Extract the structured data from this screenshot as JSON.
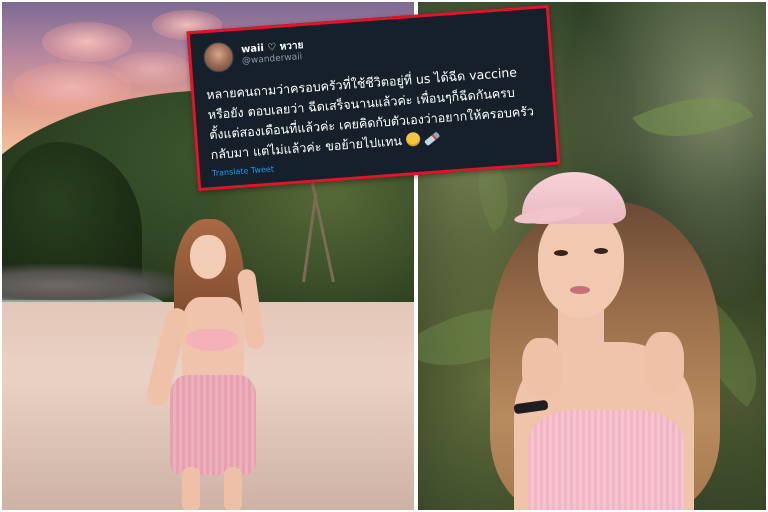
{
  "tweet": {
    "display_name": "waii ♡ หวาย",
    "handle": "@wanderwaii",
    "text_lines": [
      "หลายคนถามว่าครอบครัวที่ใช้ชีวิตอยู่ที่ us ได้ฉีด vaccine",
      "หรือยัง ตอบเลยว่า ฉีดเสร็จนานแล้วค่ะ เพื่อนๆก็ฉีดกันครบ",
      "ตั้งแต่สองเดือนที่แล้วค่ะ เคยคิดกับตัวเองว่าอยากให้ครอบครัว",
      "กลับมา แต่ไม่แล้วค่ะ ขอย้ายไปแทน"
    ],
    "emojis": [
      "smiling-face-emoji",
      "syringe-emoji"
    ],
    "translate_label": "Translate Tweet",
    "border_color": "#e0142b",
    "background_color": "#15202b",
    "link_color": "#1d9bf0"
  },
  "photos": {
    "left_scene": "beach",
    "right_scene": "portrait-foliage"
  }
}
